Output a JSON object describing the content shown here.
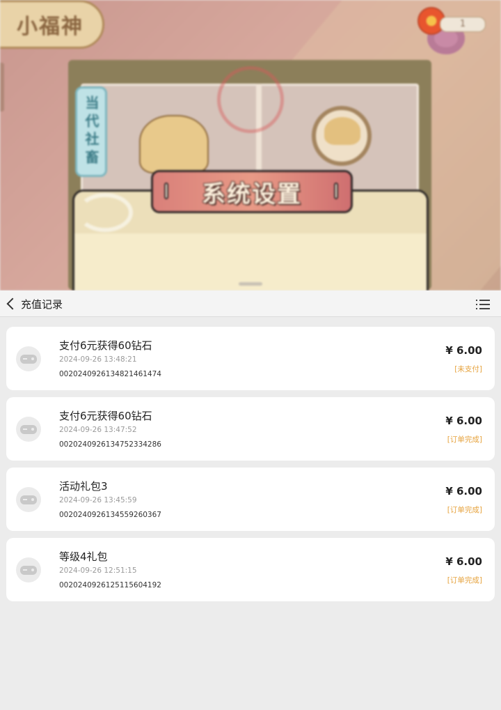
{
  "game": {
    "badge_title": "小福神",
    "counter": "1",
    "ribbon_text": "当代社畜",
    "dialog_title": "系统设置"
  },
  "nav": {
    "title": "充值记录",
    "back_icon": "chevron-left-icon",
    "menu_icon": "list-icon"
  },
  "colors": {
    "status": "#e6a23c",
    "card": "#ffffff",
    "page_bg": "#ececec"
  },
  "records": [
    {
      "title": "支付6元获得60钻石",
      "time": "2024-09-26 13:48:21",
      "order": "0020240926134821461474",
      "price": "¥ 6.00",
      "status": "[未支付]",
      "icon": "gamepad-icon"
    },
    {
      "title": "支付6元获得60钻石",
      "time": "2024-09-26 13:47:52",
      "order": "0020240926134752334286",
      "price": "¥ 6.00",
      "status": "[订单完成]",
      "icon": "gamepad-icon"
    },
    {
      "title": "活动礼包3",
      "time": "2024-09-26 13:45:59",
      "order": "0020240926134559260367",
      "price": "¥ 6.00",
      "status": "[订单完成]",
      "icon": "gamepad-icon"
    },
    {
      "title": "等级4礼包",
      "time": "2024-09-26 12:51:15",
      "order": "0020240926125115604192",
      "price": "¥ 6.00",
      "status": "[订单完成]",
      "icon": "gamepad-icon"
    }
  ]
}
